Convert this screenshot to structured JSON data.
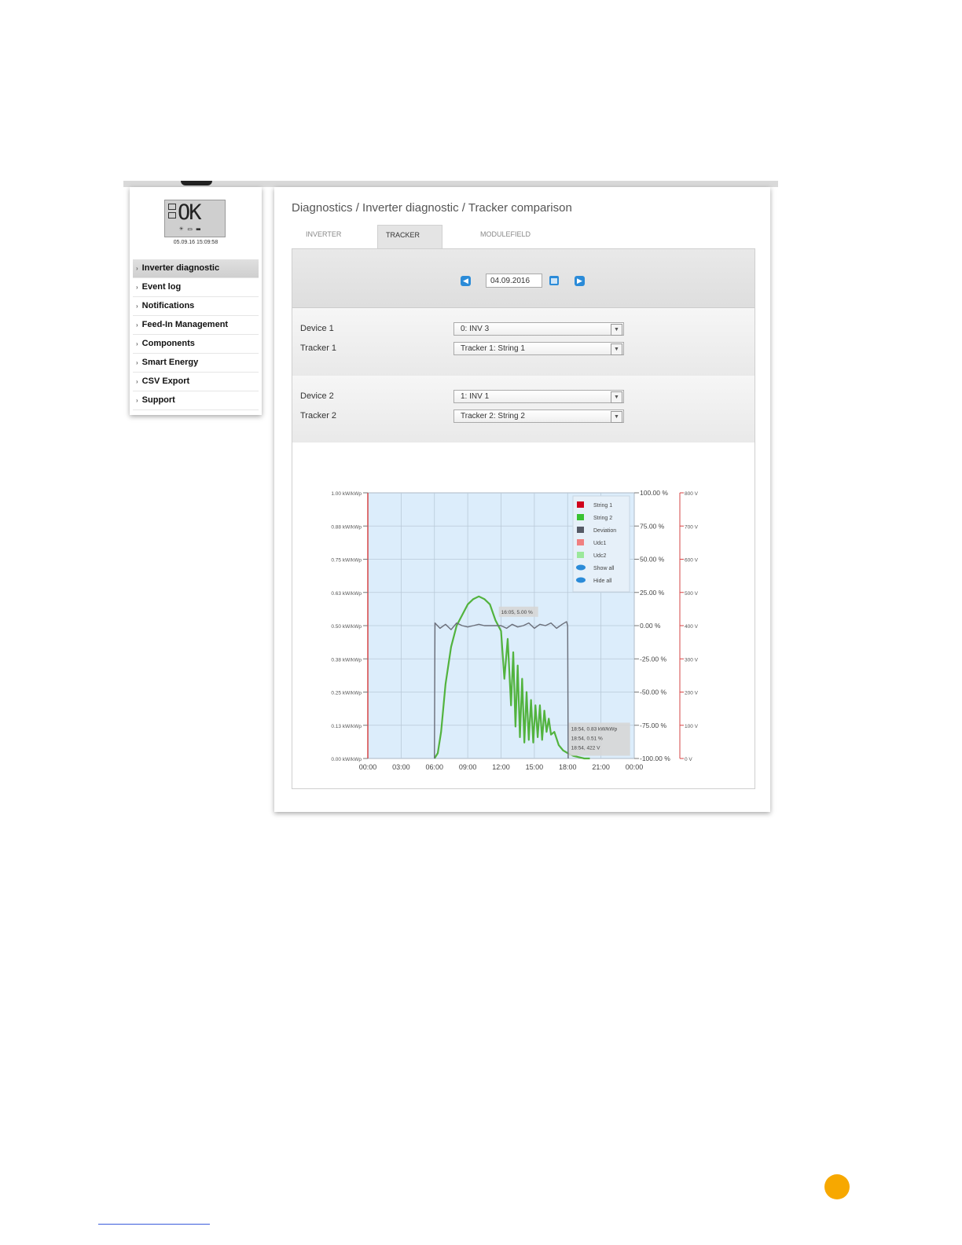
{
  "sidebar": {
    "display": {
      "main": "OK",
      "bottom": "☀ ▭ ▬"
    },
    "timestamp": "05.09.16 15:09:58",
    "items": [
      {
        "label": "Inverter diagnostic",
        "active": true
      },
      {
        "label": "Event log"
      },
      {
        "label": "Notifications"
      },
      {
        "label": "Feed-In Management"
      },
      {
        "label": "Components"
      },
      {
        "label": "Smart Energy"
      },
      {
        "label": "CSV Export"
      },
      {
        "label": "Support"
      }
    ]
  },
  "main": {
    "breadcrumb": "Diagnostics / Inverter diagnostic / Tracker comparison",
    "tabs": [
      {
        "label": "INVERTER DETAILS"
      },
      {
        "label": "TRACKER COMPARISON",
        "active": true
      },
      {
        "label": "MODULEFIELD COMPARISON"
      }
    ],
    "date": "04.09.2016",
    "device1_label": "Device 1",
    "device1_value": "0: INV 3",
    "tracker1_label": "Tracker 1",
    "tracker1_value": "Tracker 1: String 1",
    "device2_label": "Device 2",
    "device2_value": "1: INV 1",
    "tracker2_label": "Tracker 2",
    "tracker2_value": "Tracker 2: String 2"
  },
  "chart_data": {
    "type": "line",
    "x_ticks": [
      "00:00",
      "03:00",
      "06:00",
      "09:00",
      "12:00",
      "15:00",
      "18:00",
      "21:00",
      "00:00"
    ],
    "y_left_ticks": [
      "0.00 kW/kWp",
      "0.13 kW/kWp",
      "0.25 kW/kWp",
      "0.38 kW/kWp",
      "0.50 kW/kWp",
      "0.63 kW/kWp",
      "0.75 kW/kWp",
      "0.88 kW/kWp",
      "1.00 kW/kWp"
    ],
    "y_mid_ticks": [
      "-100.00 %",
      "-75.00 %",
      "-50.00 %",
      "-25.00 %",
      "0.00 %",
      "25.00 %",
      "50.00 %",
      "75.00 %",
      "100.00 %"
    ],
    "y_right_ticks": [
      "0 V",
      "100 V",
      "200 V",
      "300 V",
      "400 V",
      "500 V",
      "600 V",
      "700 V",
      "800 V"
    ],
    "ylim_left": [
      0,
      1
    ],
    "ylim_mid": [
      -100,
      100
    ],
    "ylim_right": [
      0,
      800
    ],
    "legend": [
      {
        "name": "String 1",
        "color": "#d0021b"
      },
      {
        "name": "String 2",
        "color": "#39c232"
      },
      {
        "name": "Deviation",
        "color": "#555a66"
      },
      {
        "name": "Udc1",
        "color": "#f08080"
      },
      {
        "name": "Udc2",
        "color": "#9be89b"
      },
      {
        "name": "Show all",
        "color": "#2b8bd8"
      },
      {
        "name": "Hide all",
        "color": "#2b8bd8"
      }
    ],
    "tooltip_top": "16:05, 5.00 %",
    "tooltip_bottom": [
      "18:54, 0.83 kW/kWp",
      "18:54, 0.51 %",
      "18:54, 422 V"
    ],
    "series": [
      {
        "name": "String 2",
        "color": "#52b33e",
        "x": [
          6.0,
          6.3,
          6.6,
          7.0,
          7.5,
          8.0,
          8.5,
          9.0,
          9.5,
          10.0,
          10.5,
          11.0,
          11.5,
          12.0,
          12.3,
          12.6,
          12.9,
          13.1,
          13.3,
          13.5,
          13.7,
          13.9,
          14.1,
          14.3,
          14.5,
          14.7,
          14.9,
          15.1,
          15.3,
          15.5,
          15.7,
          15.9,
          16.1,
          16.3,
          16.5,
          16.8,
          17.2,
          17.6,
          18.0,
          18.5,
          19.0,
          19.5,
          20.0
        ],
        "y": [
          0.0,
          0.02,
          0.1,
          0.28,
          0.42,
          0.5,
          0.54,
          0.58,
          0.6,
          0.61,
          0.6,
          0.58,
          0.52,
          0.48,
          0.3,
          0.45,
          0.2,
          0.4,
          0.12,
          0.35,
          0.08,
          0.3,
          0.06,
          0.25,
          0.07,
          0.22,
          0.06,
          0.2,
          0.08,
          0.2,
          0.07,
          0.18,
          0.1,
          0.15,
          0.09,
          0.1,
          0.05,
          0.03,
          0.02,
          0.01,
          0.005,
          0.0,
          0.0
        ]
      },
      {
        "name": "Deviation",
        "color": "#6b6f7a",
        "x": [
          6.0,
          6.05,
          6.5,
          7.0,
          7.5,
          8.0,
          8.5,
          9.0,
          9.5,
          10.0,
          10.5,
          11.0,
          11.5,
          12.0,
          12.5,
          13.0,
          13.5,
          14.0,
          14.5,
          15.0,
          15.5,
          16.0,
          16.5,
          17.0,
          17.5,
          17.9,
          18.0,
          18.05
        ],
        "y": [
          -100,
          2,
          -2,
          1,
          -3,
          2,
          0,
          -1,
          0,
          1,
          0,
          0,
          0,
          0,
          -2,
          1,
          -1,
          0,
          2,
          -2,
          1,
          0,
          2,
          -2,
          1,
          3,
          0,
          -100
        ]
      }
    ]
  },
  "colors": {
    "accent": "#2b8bd8",
    "plot_bg": "#dcedfb",
    "axis_red": "#d64545",
    "orange_dot": "#f7a800"
  }
}
